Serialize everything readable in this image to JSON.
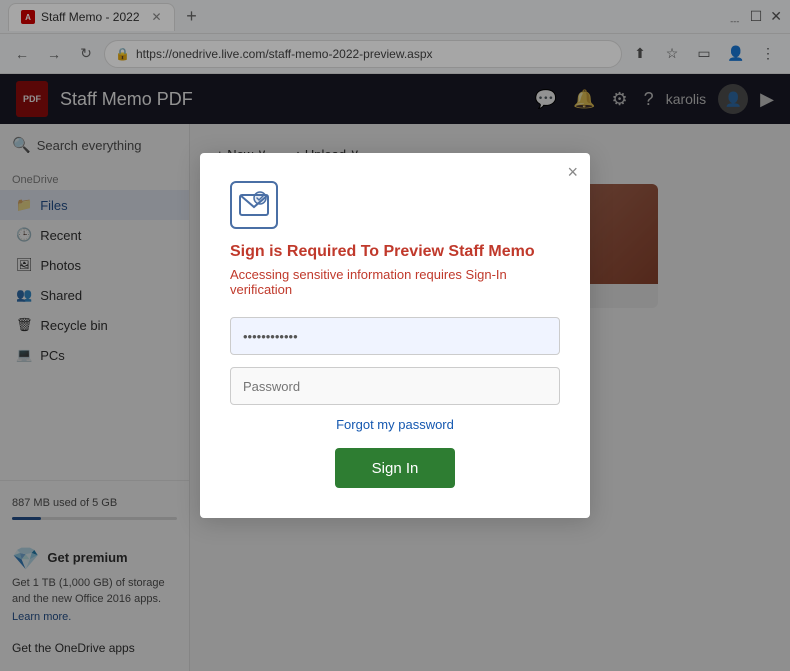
{
  "browser": {
    "tab_title": "Staff Memo - 2022",
    "new_tab_label": "+",
    "address_url": "https://onedrive.live.com/staff-memo-2022-preview.aspx",
    "nav": {
      "back": "←",
      "forward": "→",
      "refresh": "↻"
    },
    "toolbar_actions": {
      "share": "⬆",
      "bookmark": "☆",
      "profile": "👤",
      "more": "⋮"
    }
  },
  "app_header": {
    "logo_text": "PDF",
    "title": "Staff Memo PDF",
    "icons": {
      "comment": "💬",
      "bell": "🔔",
      "settings": "⚙",
      "help": "?"
    },
    "username": "karolis",
    "expand": "▶"
  },
  "sub_toolbar": {
    "new_btn": "+ New",
    "new_chevron": "∨",
    "upload_btn": "↑ Upload",
    "upload_chevron": "∨"
  },
  "sidebar": {
    "search_placeholder": "Search everything",
    "section_label": "OneDrive",
    "items": [
      {
        "label": "Files",
        "active": true
      },
      {
        "label": "Recent",
        "active": false
      },
      {
        "label": "Photos",
        "active": false
      },
      {
        "label": "Shared",
        "active": false
      },
      {
        "label": "Recycle bin",
        "active": false
      },
      {
        "label": "PCs",
        "active": false
      }
    ],
    "storage": {
      "used": "887 MB used of 5 GB",
      "fill_percent": 17.74
    },
    "premium": {
      "icon": "💎",
      "title": "Get premium",
      "description": "Get 1 TB (1,000 GB) of storage and the new Office 2016 apps.",
      "learn_more": "Learn more."
    },
    "get_apps": "Get the OneDrive apps"
  },
  "modal": {
    "close_btn": "×",
    "title": "Sign is Required To Preview Staff Memo",
    "subtitle": "Accessing sensitive information requires Sign-In verification",
    "email_prefill": "••••••••••••",
    "password_placeholder": "Password",
    "forgot_password": "Forgot my password",
    "sign_in_btn": "Sign In"
  }
}
